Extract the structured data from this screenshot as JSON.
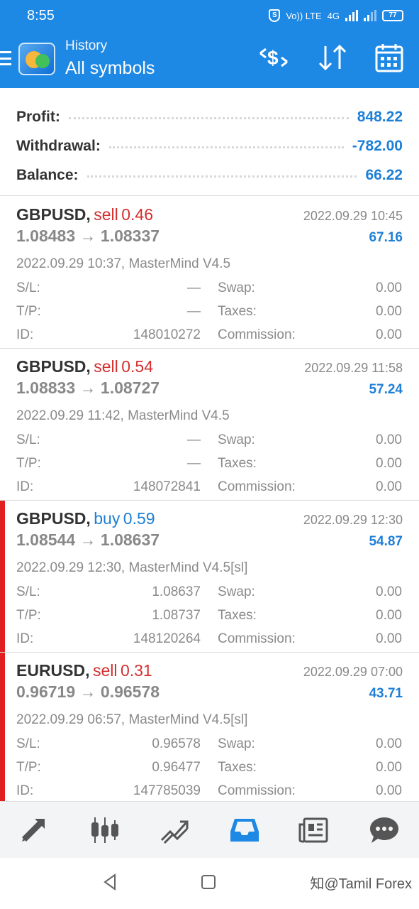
{
  "status": {
    "time": "8:55",
    "network": "Vo)) LTE",
    "network_gen": "4G",
    "battery": "77"
  },
  "header": {
    "subtitle": "History",
    "title": "All symbols"
  },
  "summary": [
    {
      "label": "Profit:",
      "value": "848.22"
    },
    {
      "label": "Withdrawal:",
      "value": "-782.00"
    },
    {
      "label": "Balance:",
      "value": "66.22"
    }
  ],
  "deals": [
    {
      "symbol": "GBPUSD,",
      "type": "sell",
      "volume": "0.46",
      "time_close": "2022.09.29 10:45",
      "prices": "1.08483 → 1.08337",
      "profit": "67.16",
      "comment": "2022.09.29 10:37, MasterMind V4.5",
      "sl_label": "S/L:",
      "sl": "—",
      "tp_label": "T/P:",
      "tp": "—",
      "id_label": "ID:",
      "id": "148010272",
      "swap_label": "Swap:",
      "swap": "0.00",
      "taxes_label": "Taxes:",
      "taxes": "0.00",
      "commission_label": "Commission:",
      "commission": "0.00"
    },
    {
      "symbol": "GBPUSD,",
      "type": "sell",
      "volume": "0.54",
      "time_close": "2022.09.29 11:58",
      "prices": "1.08833 → 1.08727",
      "profit": "57.24",
      "comment": "2022.09.29 11:42, MasterMind V4.5",
      "sl_label": "S/L:",
      "sl": "—",
      "tp_label": "T/P:",
      "tp": "—",
      "id_label": "ID:",
      "id": "148072841",
      "swap_label": "Swap:",
      "swap": "0.00",
      "taxes_label": "Taxes:",
      "taxes": "0.00",
      "commission_label": "Commission:",
      "commission": "0.00"
    },
    {
      "symbol": "GBPUSD,",
      "type": "buy",
      "volume": "0.59",
      "time_close": "2022.09.29 12:30",
      "prices": "1.08544 → 1.08637",
      "profit": "54.87",
      "comment": "2022.09.29 12:30, MasterMind V4.5[sl]",
      "sl_label": "S/L:",
      "sl": "1.08637",
      "tp_label": "T/P:",
      "tp": "1.08737",
      "id_label": "ID:",
      "id": "148120264",
      "swap_label": "Swap:",
      "swap": "0.00",
      "taxes_label": "Taxes:",
      "taxes": "0.00",
      "commission_label": "Commission:",
      "commission": "0.00"
    },
    {
      "symbol": "EURUSD,",
      "type": "sell",
      "volume": "0.31",
      "time_close": "2022.09.29 07:00",
      "prices": "0.96719 → 0.96578",
      "profit": "43.71",
      "comment": "2022.09.29 06:57, MasterMind V4.5[sl]",
      "sl_label": "S/L:",
      "sl": "0.96578",
      "tp_label": "T/P:",
      "tp": "0.96477",
      "id_label": "ID:",
      "id": "147785039",
      "swap_label": "Swap:",
      "swap": "0.00",
      "taxes_label": "Taxes:",
      "taxes": "0.00",
      "commission_label": "Commission:",
      "commission": "0.00"
    }
  ],
  "nav": [
    {
      "name": "quotes-icon"
    },
    {
      "name": "chart-icon"
    },
    {
      "name": "trade-icon"
    },
    {
      "name": "history-icon",
      "active": true
    },
    {
      "name": "news-icon"
    },
    {
      "name": "messages-icon"
    }
  ],
  "colors": {
    "primary": "#1e88e5",
    "sell": "#d32f2f",
    "buy": "#1e7fd6",
    "flag": "#e02020"
  },
  "watermark": "知@Tamil Forex"
}
